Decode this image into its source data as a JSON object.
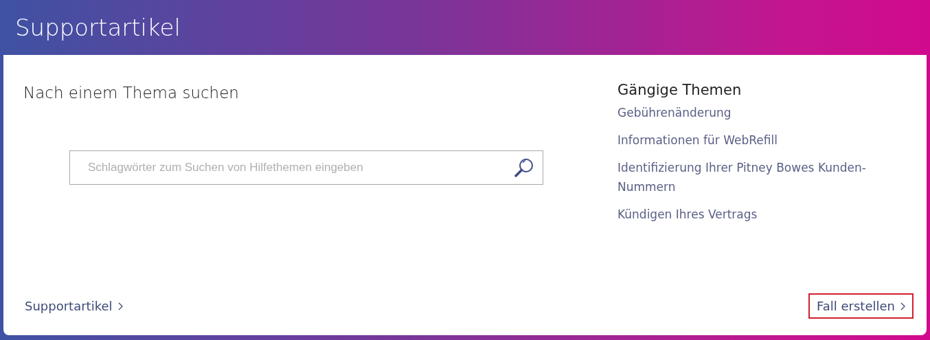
{
  "header": {
    "title": "Supportartikel"
  },
  "search": {
    "heading": "Nach einem Thema suchen",
    "placeholder": "Schlagwörter zum Suchen von Hilfethemen eingeben"
  },
  "topics": {
    "heading": "Gängige Themen",
    "items": [
      "Gebührenänderung",
      "Informationen für WebRefill",
      "Identifizierung Ihrer Pitney Bowes Kunden-Nummern",
      "Kündigen Ihres Vertrags"
    ]
  },
  "footer_links": [
    {
      "label": "Supportartikel",
      "focused": false
    },
    {
      "label": "Fall erstellen",
      "focused": true
    }
  ]
}
